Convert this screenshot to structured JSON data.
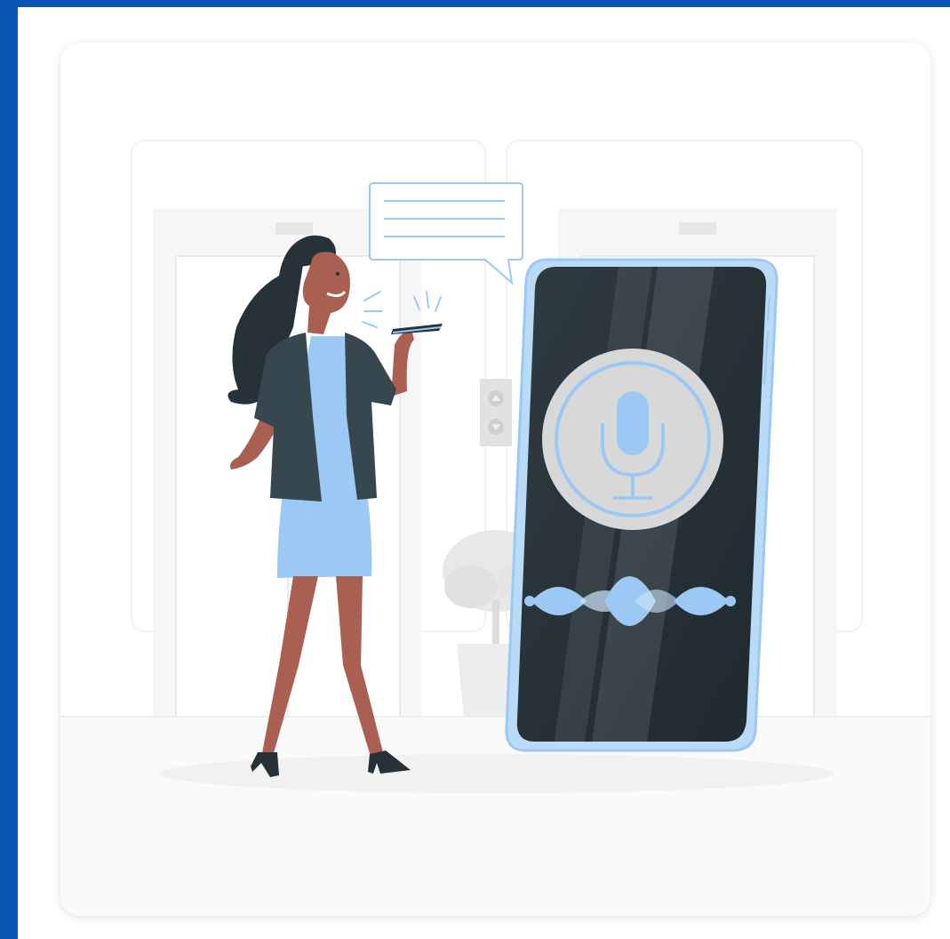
{
  "colors": {
    "frame": "#0a55b5",
    "accent": "#9cc9f4",
    "phone_screen": "#263238",
    "jacket": "#37474f",
    "skin": "#a95f52",
    "hair": "#263238"
  },
  "icons": [
    "speech-bubble-icon",
    "microphone-icon",
    "sound-wave-icon",
    "elevator-buttons-icon"
  ]
}
